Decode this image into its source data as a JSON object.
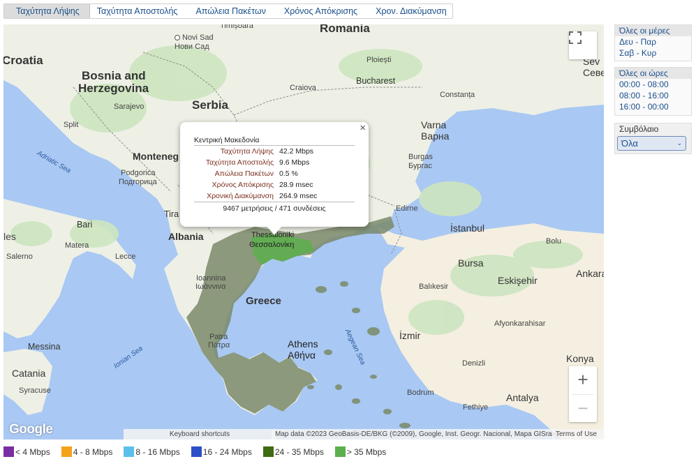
{
  "tabs": [
    {
      "label": "Ταχύτητα Λήψης",
      "active": true
    },
    {
      "label": "Ταχύτητα Αποστολής"
    },
    {
      "label": "Απώλεια Πακέτων"
    },
    {
      "label": "Χρόνος Απόκρισης"
    },
    {
      "label": "Χρον. Διακύμανση"
    }
  ],
  "map": {
    "labels": {
      "croatia": "Croatia",
      "bosnia1": "Bosnia and",
      "bosnia2": "Herzegovina",
      "novi_sad": "Novi Sad",
      "novi_sad_gr": "Нови Сад",
      "timisoara": "Timișoara",
      "romania": "Romania",
      "sarajevo": "Sarajevo",
      "serbia": "Serbia",
      "craiova": "Craiova",
      "bucharest": "Bucharest",
      "ploiesti": "Ploiești",
      "constanta": "Constanța",
      "split": "Split",
      "adriatic": "Adriatic Sea",
      "montenegro": "Monteneg",
      "podgorica": "Podgorica",
      "podgorica_cyr": "Подгорица",
      "varna": "Varna",
      "varna_cyr": "Варна",
      "burgas": "Burgas",
      "burgas_cyr": "Бургас",
      "edirne": "Edirne",
      "tirana": "Tira",
      "bari": "Bari",
      "albania": "Albania",
      "thessaloniki": "Thessaloniki",
      "thessaloniki_gr": "Θεσσαλονίκη",
      "istanbul": "İstanbul",
      "bolu": "Bolu",
      "matera": "Matera",
      "salerno": "Salerno",
      "lecce": "Lecce",
      "bursa": "Bursa",
      "eskisehir": "Eskişehir",
      "ankara": "Ankara",
      "ioannina": "Ioannina",
      "ioannina_gr": "Ιωάννινα",
      "greece": "Greece",
      "balikesir": "Balıkesir",
      "afyon": "Afyonkarahisar",
      "messina": "Messina",
      "patra": "Patra",
      "patra_gr": "Πάτρα",
      "athens": "Athens",
      "athens_gr": "Αθήνα",
      "izmir": "İzmir",
      "ionian": "Ionian Sea",
      "aegean": "Aegean Sea",
      "catania": "Catania",
      "syracuse": "Syracuse",
      "denizli": "Denizli",
      "konya": "Konya",
      "bodrum": "Bodrum",
      "antalya": "Antalya",
      "fethiye": "Fethiye",
      "les": "les",
      "sev1": "Sev",
      "sev2": "Севе"
    },
    "attribution": {
      "shortcuts": "Keyboard shortcuts",
      "data": "Map data ©2023 GeoBasis-DE/BKG (©2009), Google, Inst. Geogr. Nacional, Mapa GISrael",
      "terms": "Terms of Use"
    },
    "google": "Google",
    "zoom_in": "+",
    "zoom_out": "−",
    "fullscreen_icon": "fullscreen-icon"
  },
  "popup": {
    "region": "Κεντρική Μακεδονία",
    "rows": [
      {
        "k": "Ταχύτητα Λήψης",
        "v": "42.2 Mbps"
      },
      {
        "k": "Ταχύτητα Αποστολής",
        "v": "9.6 Mbps"
      },
      {
        "k": "Απώλεια Πακέτων",
        "v": "0.5 %"
      },
      {
        "k": "Χρόνος Απόκρισης",
        "v": "28.9 msec"
      },
      {
        "k": "Χρονική Διακύμανση",
        "v": "264.9 msec"
      }
    ],
    "summary": "9467 μετρήσεις / 471 συνδέσεις",
    "close": "×"
  },
  "days": {
    "header": "Όλες οι μέρες",
    "items": [
      "Δευ - Παρ",
      "Σαβ - Κυρ"
    ]
  },
  "hours": {
    "header": "Όλες οι ώρες",
    "items": [
      "00:00 - 08:00",
      "08:00 - 16:00",
      "16:00 - 00:00"
    ]
  },
  "contract": {
    "label": "Συμβόλαιο",
    "value": "Όλα"
  },
  "legend": [
    {
      "label": "< 4 Mbps",
      "color": "#7b2ea3"
    },
    {
      "label": "4 - 8 Mbps",
      "color": "#f5a21b"
    },
    {
      "label": "8 - 16 Mbps",
      "color": "#5cc0ea"
    },
    {
      "label": "16 - 24 Mbps",
      "color": "#2c4fc7"
    },
    {
      "label": "24 - 35 Mbps",
      "color": "#3f6b12"
    },
    {
      "label": "> 35 Mbps",
      "color": "#5caf4c"
    }
  ]
}
